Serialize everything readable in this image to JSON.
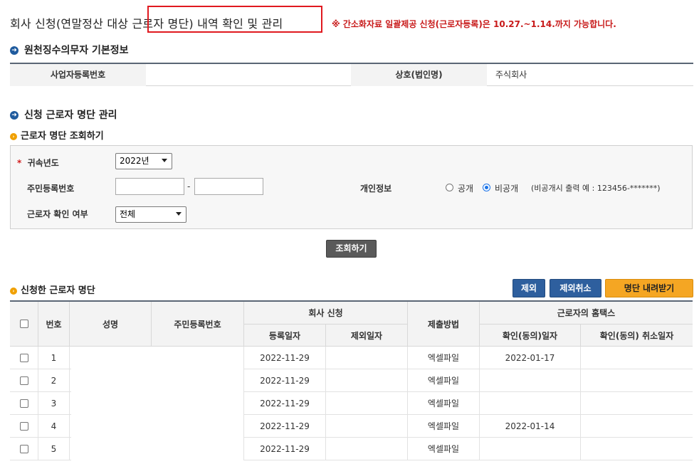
{
  "page": {
    "title": "회사 신청(연말정산 대상 근로자 명단) 내역 확인 및 관리",
    "notice": "※ 간소화자료 일괄제공 신청(근로자등록)은 10.27.~1.14.까지 가능합니다."
  },
  "basic_info": {
    "section_title": "원천징수의무자 기본정보",
    "reg_no_label": "사업자등록번호",
    "reg_no_value": "",
    "company_label": "상호(법인명)",
    "company_value": "주식회사"
  },
  "manage": {
    "section_title": "신청 근로자 명단 관리",
    "search_title": "근로자 명단 조회하기",
    "year_label": "귀속년도",
    "year_value": "2022년",
    "resident_label": "주민등록번호",
    "resident_front": "",
    "resident_back": "",
    "resident_sep": "-",
    "privacy_label": "개인정보",
    "privacy_public": "공개",
    "privacy_private": "비공개",
    "privacy_selected": "비공개",
    "privacy_hint": "(비공개시 출력 예 : 123456-*******)",
    "confirm_label": "근로자 확인 여부",
    "confirm_value": "전체",
    "search_button": "조회하기"
  },
  "list": {
    "title": "신청한 근로자 명단",
    "exclude_button": "제외",
    "exclude_cancel_button": "제외취소",
    "download_button": "명단 내려받기",
    "headers": {
      "no": "번호",
      "name": "성명",
      "resident_no": "주민등록번호",
      "company_apply": "회사 신청",
      "reg_date": "등록일자",
      "excl_date": "제외일자",
      "submit_method": "제출방법",
      "hometax": "근로자의 홈택스",
      "confirm_date": "확인(동의)일자",
      "confirm_cancel_date": "확인(동의) 취소일자"
    },
    "rows": [
      {
        "no": "1",
        "name": "",
        "resident_no": "",
        "reg_date": "2022-11-29",
        "excl_date": "",
        "method": "엑셀파일",
        "confirm_date": "2022-01-17",
        "cancel_date": ""
      },
      {
        "no": "2",
        "name": "",
        "resident_no": "",
        "reg_date": "2022-11-29",
        "excl_date": "",
        "method": "엑셀파일",
        "confirm_date": "",
        "cancel_date": ""
      },
      {
        "no": "3",
        "name": "",
        "resident_no": "",
        "reg_date": "2022-11-29",
        "excl_date": "",
        "method": "엑셀파일",
        "confirm_date": "",
        "cancel_date": ""
      },
      {
        "no": "4",
        "name": "",
        "resident_no": "",
        "reg_date": "2022-11-29",
        "excl_date": "",
        "method": "엑셀파일",
        "confirm_date": "2022-01-14",
        "cancel_date": ""
      },
      {
        "no": "5",
        "name": "",
        "resident_no": "",
        "reg_date": "2022-11-29",
        "excl_date": "",
        "method": "엑셀파일",
        "confirm_date": "",
        "cancel_date": ""
      }
    ]
  },
  "colors": {
    "accent_blue": "#2e5f9e",
    "accent_orange": "#f5a623",
    "notice_red": "#c81a1a",
    "highlight_red": "#e0191f"
  }
}
